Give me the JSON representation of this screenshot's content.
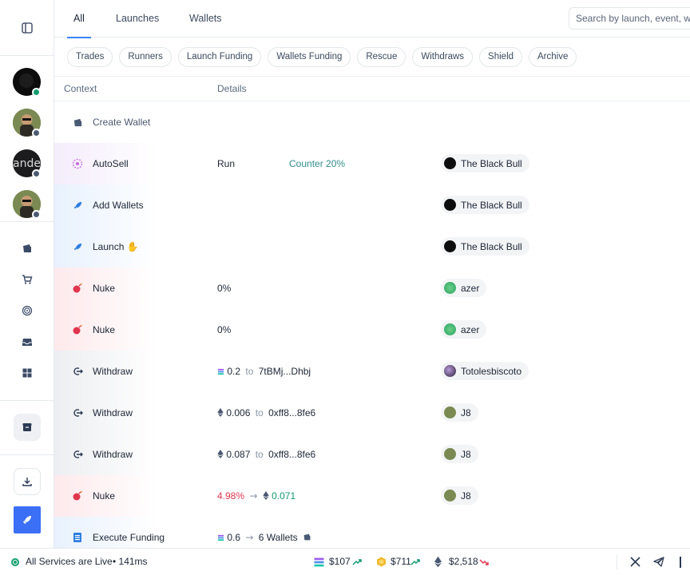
{
  "sidebar": {
    "avatars": [
      {
        "label": "",
        "status": "online",
        "status_color": "#12a06e"
      },
      {
        "label": "",
        "status": "offline",
        "status_color": "#4b5a70"
      },
      {
        "label": "ande",
        "status": "offline",
        "status_color": "#4b5a70"
      },
      {
        "label": "",
        "status": "offline",
        "status_color": "#4b5a70"
      }
    ],
    "nav_icons": [
      "layout-sidebar-icon",
      "wallet-icon",
      "cart-icon",
      "fingerprint-icon",
      "inbox-icon",
      "grid-icon",
      "archive-box-icon",
      "download-icon",
      "rocket-icon"
    ]
  },
  "tabs": [
    {
      "label": "All",
      "active": true
    },
    {
      "label": "Launches",
      "active": false
    },
    {
      "label": "Wallets",
      "active": false
    }
  ],
  "search": {
    "placeholder": "Search by launch, event, w"
  },
  "chips": [
    "Trades",
    "Runners",
    "Launch Funding",
    "Wallets Funding",
    "Rescue",
    "Withdraws",
    "Shield",
    "Archive"
  ],
  "table": {
    "headers": {
      "context": "Context",
      "details": "Details"
    },
    "rows": [
      {
        "name": "Create Wallet",
        "icon": "wallet-icon",
        "bg": "none"
      },
      {
        "name": "AutoSell",
        "icon": "autosell-icon",
        "bg": "violet",
        "detail1": "Run",
        "detail2": "Counter 20%",
        "owner": "The Black Bull"
      },
      {
        "name": "Add Wallets",
        "icon": "rocket-icon",
        "bg": "blue",
        "owner": "The Black Bull"
      },
      {
        "name": "Launch",
        "emoji": "✋",
        "icon": "rocket-icon",
        "bg": "blue",
        "owner": "The Black Bull"
      },
      {
        "name": "Nuke",
        "icon": "bomb-icon",
        "bg": "red",
        "detail1": "0%",
        "owner": "azer"
      },
      {
        "name": "Nuke",
        "icon": "bomb-icon",
        "bg": "red",
        "detail1": "0%",
        "owner": "azer"
      },
      {
        "name": "Withdraw",
        "icon": "withdraw-icon",
        "bg": "gray",
        "amount": "0.2",
        "to": "to",
        "address": "7tBMj...Dhbj",
        "chain": "sol",
        "owner": "Totolesbiscoto"
      },
      {
        "name": "Withdraw",
        "icon": "withdraw-icon",
        "bg": "gray",
        "amount": "0.006",
        "to": "to",
        "address": "0xff8...8fe6",
        "chain": "eth",
        "owner": "J8"
      },
      {
        "name": "Withdraw",
        "icon": "withdraw-icon",
        "bg": "gray",
        "amount": "0.087",
        "to": "to",
        "address": "0xff8...8fe6",
        "chain": "eth",
        "owner": "J8"
      },
      {
        "name": "Nuke",
        "icon": "bomb-icon",
        "bg": "red",
        "from_pct": "4.98%",
        "arrow": "→",
        "eth_amount": "0.071",
        "owner": "J8"
      },
      {
        "name": "Execute Funding",
        "icon": "document-icon",
        "bg": "blue",
        "amount": "0.6",
        "arrow": "→",
        "wallets": "6 Wallets"
      }
    ]
  },
  "footer": {
    "status": "All Services are Live",
    "latency": "• 141ms",
    "prices": [
      {
        "symbol": "sol",
        "value": "$107",
        "trend": "up"
      },
      {
        "symbol": "bnb",
        "value": "$711",
        "trend": "up"
      },
      {
        "symbol": "eth",
        "value": "$2,518",
        "trend": "down"
      }
    ]
  },
  "colors": {
    "accent": "#3b6ff5",
    "green": "#0f9b6c",
    "red": "#e0364f",
    "teal": "#2f8e8a"
  }
}
